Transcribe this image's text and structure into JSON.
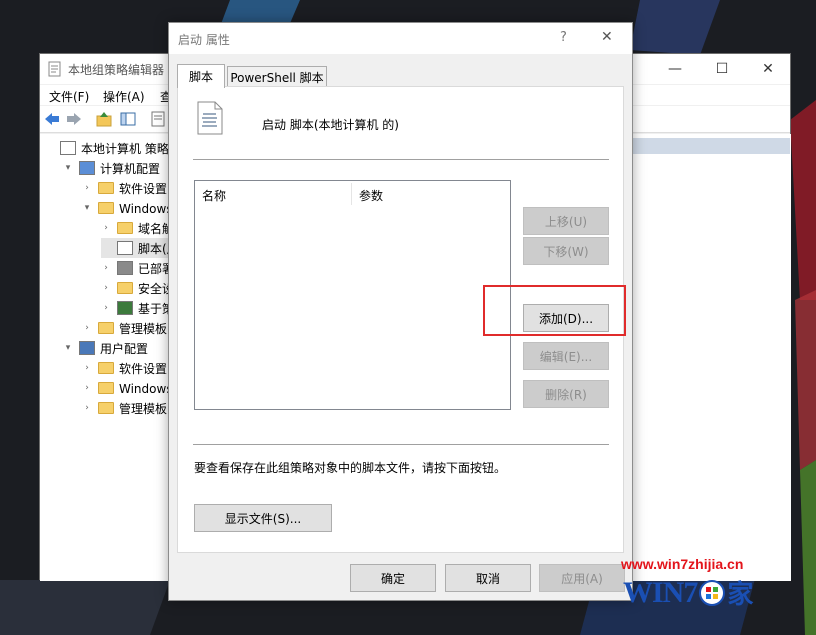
{
  "editor": {
    "title": "本地组策略编辑器",
    "menu": [
      "文件(F)",
      "操作(A)",
      "查"
    ],
    "tree": [
      {
        "label": "本地计算机 策略",
        "indent": 0,
        "arrow": ""
      },
      {
        "label": "计算机配置",
        "indent": 1,
        "arrow": "▾"
      },
      {
        "label": "软件设置",
        "indent": 2,
        "arrow": "›"
      },
      {
        "label": "Windows 设",
        "indent": 2,
        "arrow": "▾"
      },
      {
        "label": "域名解析",
        "indent": 3,
        "arrow": "›"
      },
      {
        "label": "脚本(启动",
        "indent": 3,
        "arrow": ""
      },
      {
        "label": "已部署的",
        "indent": 3,
        "arrow": "›"
      },
      {
        "label": "安全设置",
        "indent": 3,
        "arrow": "›"
      },
      {
        "label": "基于策略",
        "indent": 3,
        "arrow": "›"
      },
      {
        "label": "管理模板",
        "indent": 2,
        "arrow": "›"
      },
      {
        "label": "用户配置",
        "indent": 1,
        "arrow": "▾"
      },
      {
        "label": "软件设置",
        "indent": 2,
        "arrow": "›"
      },
      {
        "label": "Windows 设",
        "indent": 2,
        "arrow": "›"
      },
      {
        "label": "管理模板",
        "indent": 2,
        "arrow": "›"
      }
    ]
  },
  "dialog": {
    "title": "启动 属性",
    "help": "?",
    "close": "✕",
    "tabs": [
      "脚本",
      "PowerShell 脚本"
    ],
    "header_text": "启动 脚本(本地计算机 的)",
    "columns": [
      "名称",
      "参数"
    ],
    "buttons": {
      "move_up": "上移(U)",
      "move_down": "下移(W)",
      "add": "添加(D)...",
      "edit": "编辑(E)...",
      "delete": "删除(R)"
    },
    "info_text": "要查看保存在此组策略对象中的脚本文件，请按下面按钮。",
    "show_files": "显示文件(S)...",
    "ok": "确定",
    "cancel": "取消",
    "apply": "应用(A)"
  },
  "watermark": {
    "url": "www.win7zhijia.cn",
    "logo_text": "WIN7",
    "logo_tail": "家"
  },
  "colors": {
    "highlight": "#e02b2b",
    "watermark_red": "#e3141b",
    "watermark_blue": "#1a4fb3"
  }
}
